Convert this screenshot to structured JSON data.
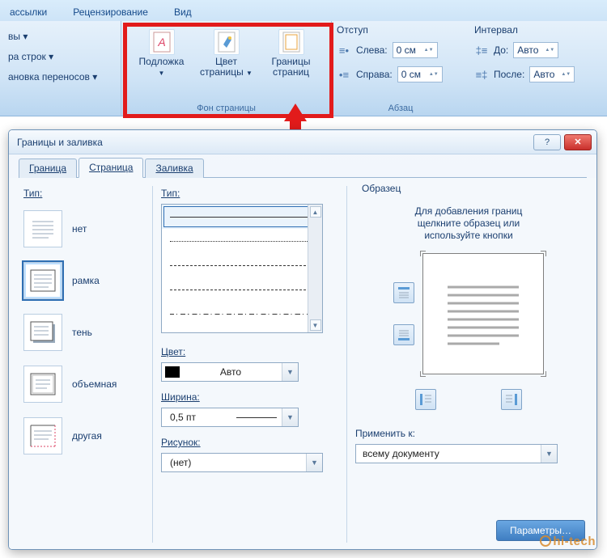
{
  "ribbon": {
    "tabs": {
      "references": "ассылки",
      "review": "Рецензирование",
      "view": "Вид"
    },
    "page_setup_partial": {
      "btn1": "вы ▾",
      "btn2": "ра строк ▾",
      "btn3": "ановка переносов ▾"
    },
    "page_bg": {
      "watermark": "Подложка",
      "page_color": "Цвет страницы",
      "borders": "Границы страниц",
      "group": "Фон страницы"
    },
    "indent": {
      "title": "Отступ",
      "left": "Слева:",
      "right": "Справа:",
      "left_val": "0 см",
      "right_val": "0 см"
    },
    "spacing": {
      "title": "Интервал",
      "before": "До:",
      "after": "После:",
      "before_val": "Авто",
      "after_val": "Авто"
    },
    "paragraph_group": "Абзац"
  },
  "dialog": {
    "title": "Границы и заливка",
    "tabs": {
      "border": "Граница",
      "page": "Страница",
      "fill": "Заливка"
    },
    "left": {
      "label": "Тип:",
      "opts": {
        "none": "нет",
        "box": "рамка",
        "shadow": "тень",
        "threeD": "объемная",
        "custom": "другая"
      }
    },
    "mid": {
      "type": "Тип:",
      "color": "Цвет:",
      "color_val": "Авто",
      "width": "Ширина:",
      "width_val": "0,5 пт",
      "art": "Рисунок:",
      "art_val": "(нет)"
    },
    "right": {
      "legend": "Образец",
      "hint1": "Для добавления границ",
      "hint2": "щелкните образец или",
      "hint3": "используйте кнопки",
      "apply": "Применить к:",
      "apply_val": "всему документу"
    },
    "footer_btn": "Параметры…"
  },
  "watermark": "hi-tech"
}
